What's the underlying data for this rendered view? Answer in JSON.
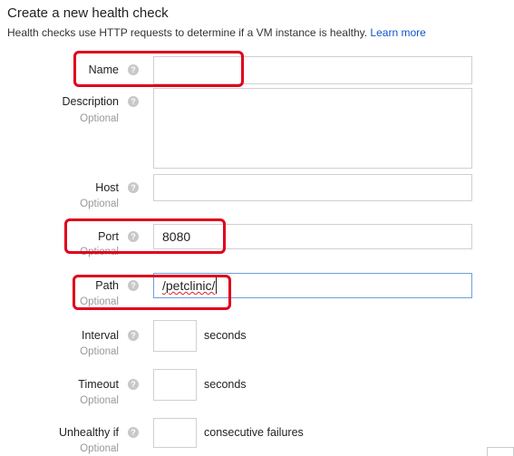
{
  "header": {
    "title": "Create a new health check",
    "subtitle": "Health checks use HTTP requests to determine if a VM instance is healthy.",
    "learn_more": "Learn more"
  },
  "help_glyph": "?",
  "fields": {
    "name": {
      "label": "Name",
      "value": ""
    },
    "description": {
      "label": "Description",
      "optional": "Optional",
      "value": ""
    },
    "host": {
      "label": "Host",
      "optional": "Optional",
      "value": ""
    },
    "port": {
      "label": "Port",
      "optional": "Optional",
      "value": "8080"
    },
    "path": {
      "label": "Path",
      "optional": "Optional",
      "value": "/petclinic/"
    },
    "interval": {
      "label": "Interval",
      "optional": "Optional",
      "value": "",
      "unit": "seconds"
    },
    "timeout": {
      "label": "Timeout",
      "optional": "Optional",
      "value": "",
      "unit": "seconds"
    },
    "unhealthy": {
      "label": "Unhealthy if",
      "optional": "Optional",
      "value": "",
      "unit": "consecutive failures"
    }
  },
  "annotation_color": "#e0001b"
}
